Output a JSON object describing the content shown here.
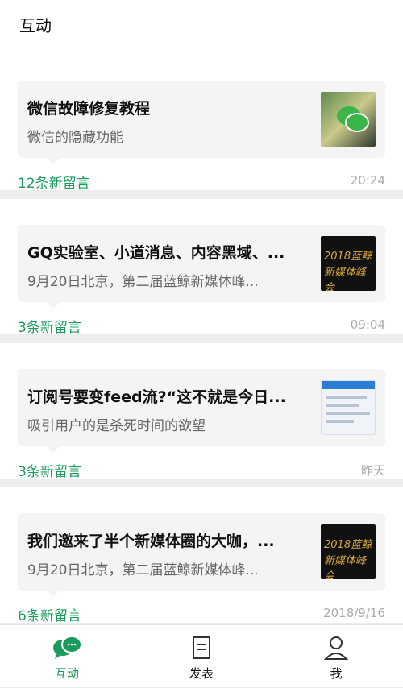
{
  "header": {
    "title": "互动"
  },
  "articles": [
    {
      "title": "微信故障修复教程",
      "subtitle": "微信的隐藏功能",
      "comments": "12条新留言",
      "time": "20:24",
      "thumb": "wechat-photo"
    },
    {
      "title": "GQ实验室、小道消息、内容黑域、...",
      "subtitle": "9月20日北京，第二届蓝鲸新媒体峰...",
      "comments": "3条新留言",
      "time": "09:04",
      "thumb": "summit-poster"
    },
    {
      "title": "订阅号要变feed流?“这不就是今日...",
      "subtitle": "吸引用户的是杀死时间的欲望",
      "comments": "3条新留言",
      "time": "昨天",
      "thumb": "feed-screenshot"
    },
    {
      "title": "我们邀来了半个新媒体圈的大咖，...",
      "subtitle": "9月20日北京，第二届蓝鲸新媒体峰...",
      "comments": "6条新留言",
      "time": "2018/9/16",
      "thumb": "summit-poster"
    }
  ],
  "summit_thumb": {
    "line1": "2018蓝鲸",
    "line2": "新媒体峰会"
  },
  "tabs": [
    {
      "label": "互动",
      "icon": "chat-bubbles-icon",
      "active": true
    },
    {
      "label": "发表",
      "icon": "document-icon",
      "active": false
    },
    {
      "label": "我",
      "icon": "person-icon",
      "active": false
    }
  ],
  "colors": {
    "accent": "#1a9b5b",
    "background": "#ededed",
    "card": "#ffffff"
  }
}
